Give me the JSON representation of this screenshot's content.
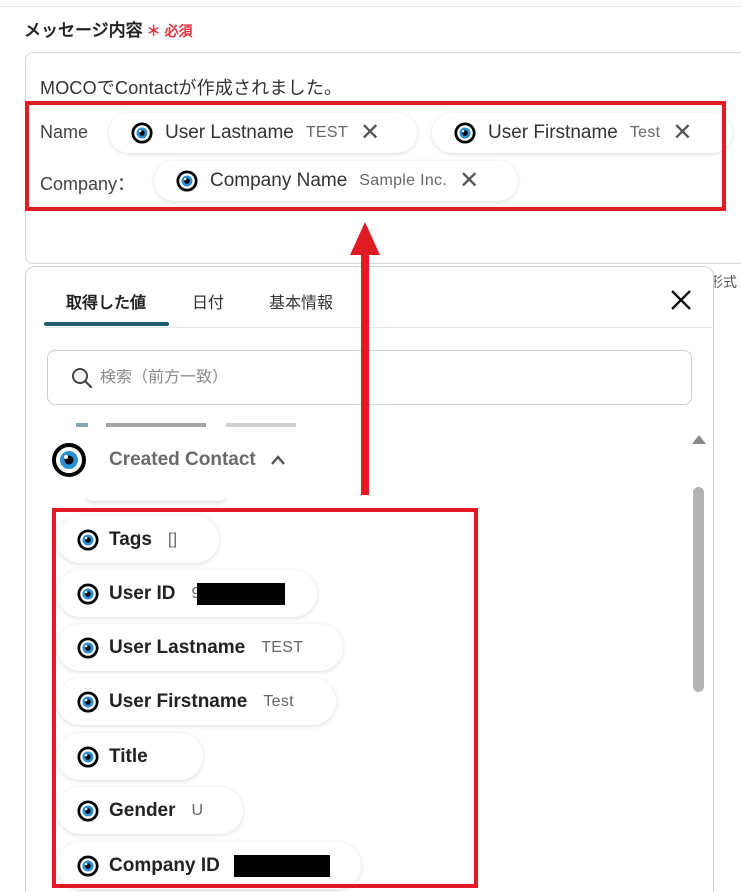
{
  "field": {
    "label": "メッセージ内容",
    "required_mark": "＊",
    "required_text": "必須"
  },
  "editor": {
    "line1": "MOCOでContactが作成されました。",
    "row1_label": "Name",
    "row2_label": "Company：",
    "chips": [
      {
        "name": "User Lastname",
        "value": "TEST",
        "remove": "✕"
      },
      {
        "name": "User Firstname",
        "value": "Test",
        "remove": "✕"
      },
      {
        "name": "Company Name",
        "value": "Sample Inc.",
        "remove": "✕"
      }
    ]
  },
  "side_cut_text": "形式",
  "panel": {
    "tabs": [
      "取得した値",
      "日付",
      "基本情報"
    ],
    "active_tab": 0,
    "search_placeholder": "検索（前方一致）",
    "group_title": "Created Contact",
    "items": [
      {
        "name": "Tags",
        "value": "[]"
      },
      {
        "name": "User ID",
        "value": "9"
      },
      {
        "name": "User Lastname",
        "value": "TEST"
      },
      {
        "name": "User Firstname",
        "value": "Test"
      },
      {
        "name": "Title",
        "value": ""
      },
      {
        "name": "Gender",
        "value": "U"
      },
      {
        "name": "Company ID",
        "value": ""
      }
    ]
  },
  "colors": {
    "highlight": "#e01b24",
    "tab_underline": "#1f5d6f",
    "required": "#e0343f",
    "icon_blue": "#2b8fd6"
  },
  "icons": [
    "moco-eye-icon",
    "close-icon",
    "search-icon",
    "chevron-up-icon",
    "scroll-up-arrow-icon"
  ]
}
